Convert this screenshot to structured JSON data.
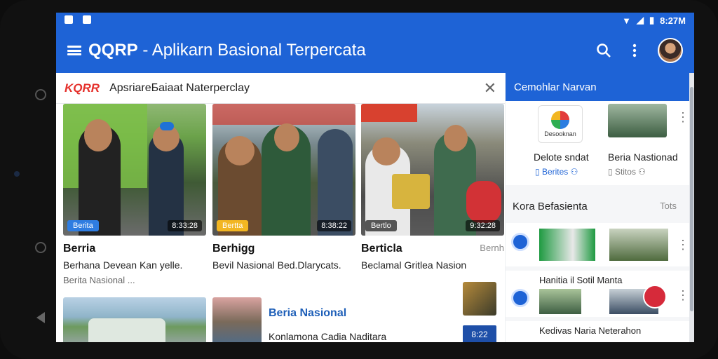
{
  "status": {
    "time": "8:27M"
  },
  "appbar": {
    "title_bold": "QQRP",
    "title_rest": " - Aplikarn Basional Terpercata"
  },
  "main_card": {
    "logo": "KQRR",
    "title": "ApsriareБaiaat Naterperclay"
  },
  "news": [
    {
      "tag": "Berita",
      "tag_color": "#2f7de1",
      "count": "8:33:28",
      "title": "Berria",
      "desc": "Berhana Devean Kan yelle.",
      "sub": "Berita Nasional ..."
    },
    {
      "tag": "Bertta",
      "tag_color": "#f2b622",
      "count": "8:38:22",
      "title": "Berhigg",
      "desc": "Bevil Nasional Bed.Dlarycats.",
      "sub": ""
    },
    {
      "tag": "Bertlo",
      "tag_color": "#555555",
      "count": "9:32:28",
      "title": "Berticla",
      "author": "Bernh",
      "desc": "Beclamal Gritlea Nasion",
      "sub": ""
    }
  ],
  "row2": {
    "title": "Beria Nasional",
    "desc": "Konlamona Cadia Naditara",
    "badge": "8:22"
  },
  "side": {
    "header": "Cemohlar Narvan",
    "top": [
      {
        "name": "Delote sndat",
        "meta": "Berites",
        "logo_text": "Desooknan"
      },
      {
        "name": "Beria Nastionad",
        "meta": "Stitos"
      }
    ],
    "section_title": "Kora Befasienta",
    "section_link": "Tots",
    "items": [
      {
        "title": "",
        "colors": [
          "#1e9a41",
          "#e8e8e8"
        ]
      },
      {
        "title": "Hanitia il Sotil Manta"
      },
      {
        "title": "Kedivas Naria Neterahon"
      }
    ]
  }
}
